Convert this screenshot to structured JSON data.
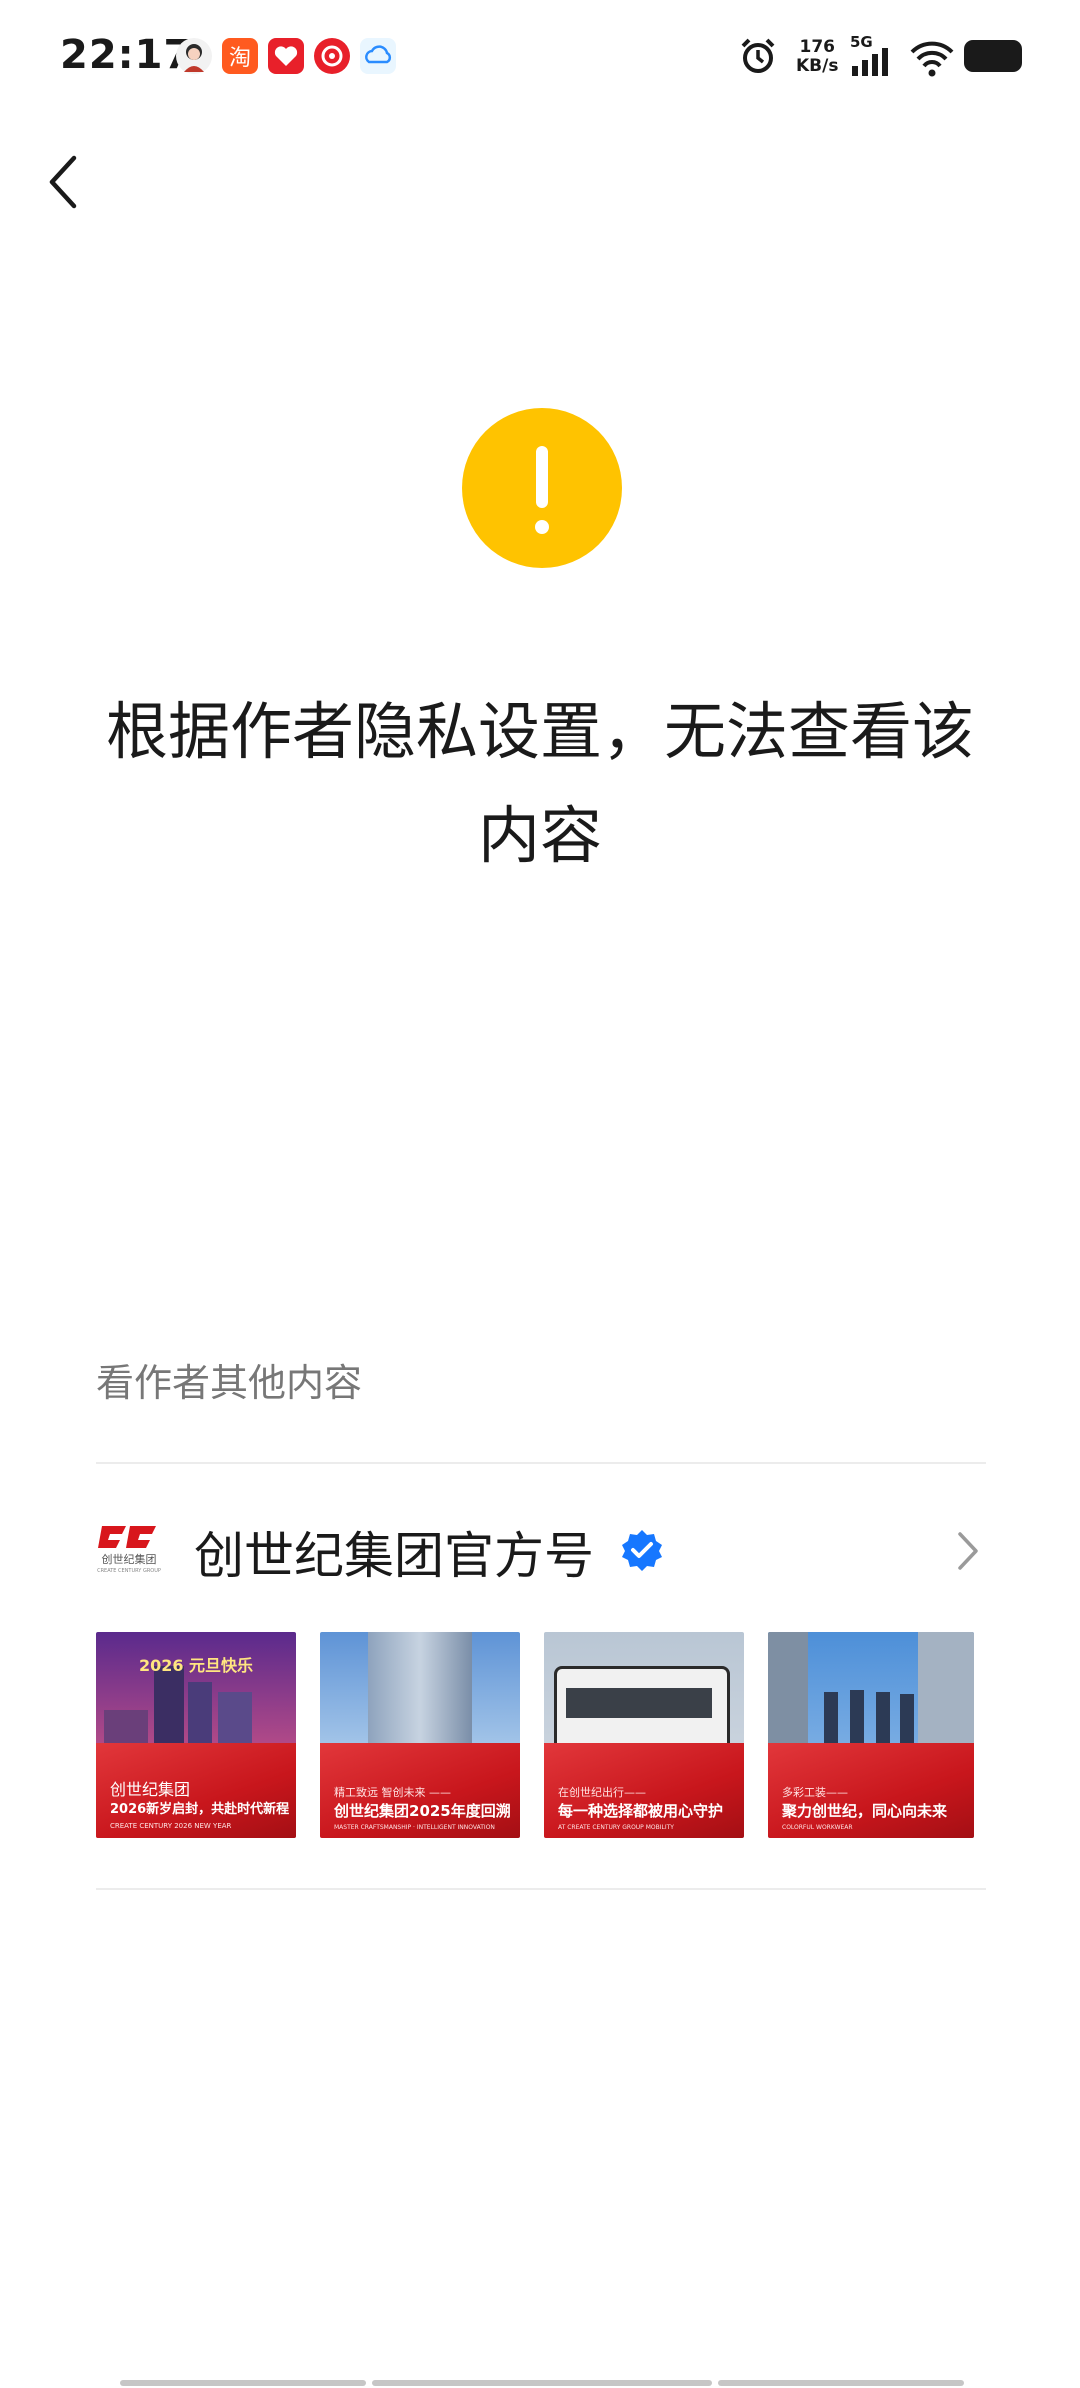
{
  "status_bar": {
    "time": "22:17",
    "net_speed_value": "176",
    "net_speed_unit": "KB/s",
    "network": "5G",
    "icons": [
      "avatar-notification-icon",
      "taobao-icon",
      "heart-app-icon",
      "music-app-icon",
      "cloud-app-icon",
      "alarm-icon",
      "signal-icon",
      "wifi-icon",
      "battery-icon"
    ]
  },
  "nav": {
    "back_icon": "chevron-left-icon"
  },
  "notice": {
    "icon": "warning-icon",
    "icon_color": "#ffc300",
    "message": "根据作者隐私设置，无法查看该内容"
  },
  "other_content": {
    "label": "看作者其他内容",
    "author": {
      "logo_text": "创世纪集团",
      "logo_subtext": "CREATE CENTURY GROUP",
      "name": "创世纪集团官方号",
      "verified_icon": "verified-badge-icon",
      "verified_color": "#1677ff"
    },
    "thumbnails": [
      {
        "top_text": "2026 元旦快乐",
        "small": "创世纪集团",
        "main": "2026新岁启封，共赴时代新程",
        "footer": "CREATE CENTURY 2026 NEW YEAR"
      },
      {
        "small": "精工致远 智创未来 ——",
        "main": "创世纪集团2025年度回溯",
        "footer": "MASTER CRAFTSMANSHIP · INTELLIGENT INNOVATION"
      },
      {
        "small": "在创世纪出行——",
        "main": "每一种选择都被用心守护",
        "footer": "AT CREATE CENTURY GROUP MOBILITY"
      },
      {
        "small": "多彩工装——",
        "main": "聚力创世纪，同心向未来",
        "footer": "COLORFUL WORKWEAR"
      }
    ]
  }
}
